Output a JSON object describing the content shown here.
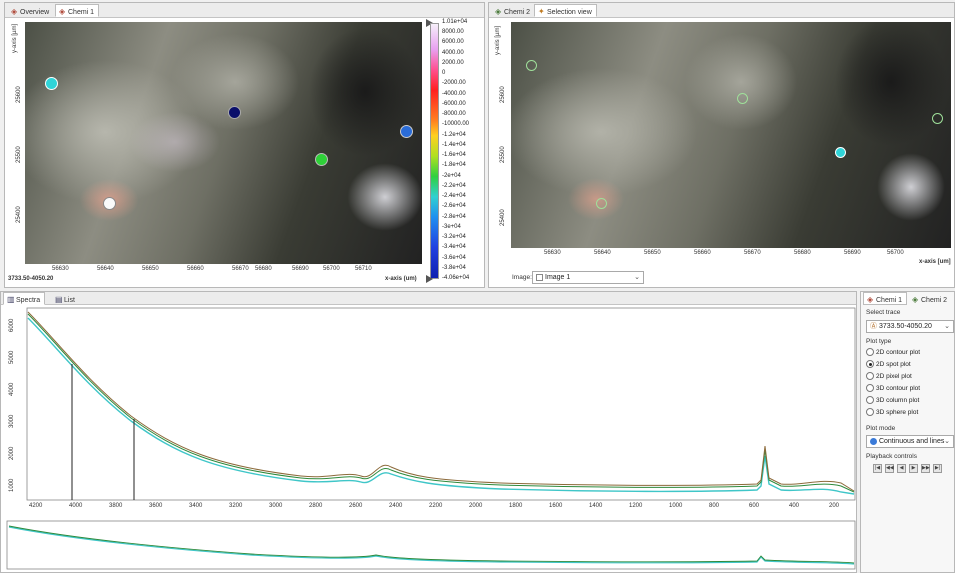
{
  "left_view": {
    "tabs": [
      {
        "label": "Overview",
        "icon": "overview-icon"
      },
      {
        "label": "Chemi 1",
        "icon": "chemi-icon"
      }
    ],
    "y_axis_label": "y-axis [µm]",
    "x_axis_label": "x-axis (um)",
    "position_readout": "3733.50-4050.20",
    "y_ticks": [
      "25400",
      "25500",
      "25600"
    ],
    "x_ticks": [
      "56630",
      "56640",
      "56650",
      "56660",
      "56670",
      "56680",
      "56690",
      "56700",
      "56710"
    ],
    "colorbar_labels": [
      "1.01e+04",
      "8000.00",
      "6000.00",
      "4000.00",
      "2000.00",
      "0",
      "-2000.00",
      "-4000.00",
      "-6000.00",
      "-8000.00",
      "-10000.00",
      "-1.2e+04",
      "-1.4e+04",
      "-1.6e+04",
      "-1.8e+04",
      "-2e+04",
      "-2.2e+04",
      "-2.4e+04",
      "-2.6e+04",
      "-2.8e+04",
      "-3e+04",
      "-3.2e+04",
      "-3.4e+04",
      "-3.6e+04",
      "-3.8e+04",
      "-4.06e+04"
    ]
  },
  "right_view": {
    "tabs": [
      {
        "label": "Chemi 2",
        "icon": "chemi-icon"
      },
      {
        "label": "Selection view",
        "icon": "selection-icon"
      }
    ],
    "y_axis_label": "y-axis [µm]",
    "x_axis_label": "x-axis [um]",
    "y_ticks": [
      "25400",
      "25500",
      "25600"
    ],
    "x_ticks": [
      "56630",
      "56640",
      "56650",
      "56660",
      "56670",
      "56680",
      "56690",
      "56700"
    ],
    "image_label": "Image:",
    "image_select": "Image 1"
  },
  "spectra": {
    "tabs": [
      {
        "label": "Spectra"
      },
      {
        "label": "List"
      }
    ],
    "y_ticks": [
      "1000",
      "2000",
      "3000",
      "4000",
      "5000",
      "6000"
    ],
    "x_ticks": [
      "4200",
      "4000",
      "3800",
      "3600",
      "3400",
      "3200",
      "3000",
      "2800",
      "2600",
      "2400",
      "2200",
      "2000",
      "1800",
      "1600",
      "1400",
      "1200",
      "1000",
      "800",
      "600",
      "400",
      "200"
    ]
  },
  "right_panel": {
    "tabs": [
      {
        "label": "Chemi 1"
      },
      {
        "label": "Chemi 2"
      }
    ],
    "select_trace_label": "Select trace",
    "select_trace_value": "3733.50-4050.20",
    "plot_type_label": "Plot type",
    "plot_types": [
      "2D contour plot",
      "2D spot plot",
      "2D pixel plot",
      "3D contour plot",
      "3D column plot",
      "3D sphere plot"
    ],
    "plot_type_selected": "2D spot plot",
    "plot_mode_label": "Plot mode",
    "plot_mode_value": "Continuous and lines",
    "playback_label": "Playback controls",
    "playback_buttons": [
      "|◀",
      "◀◀",
      "◀",
      "▶",
      "▶▶",
      "▶|"
    ]
  },
  "colors": {
    "trace_brown": "#8c6a3a",
    "trace_teal": "#3fc6c8",
    "trace_green": "#2e8a3c"
  }
}
